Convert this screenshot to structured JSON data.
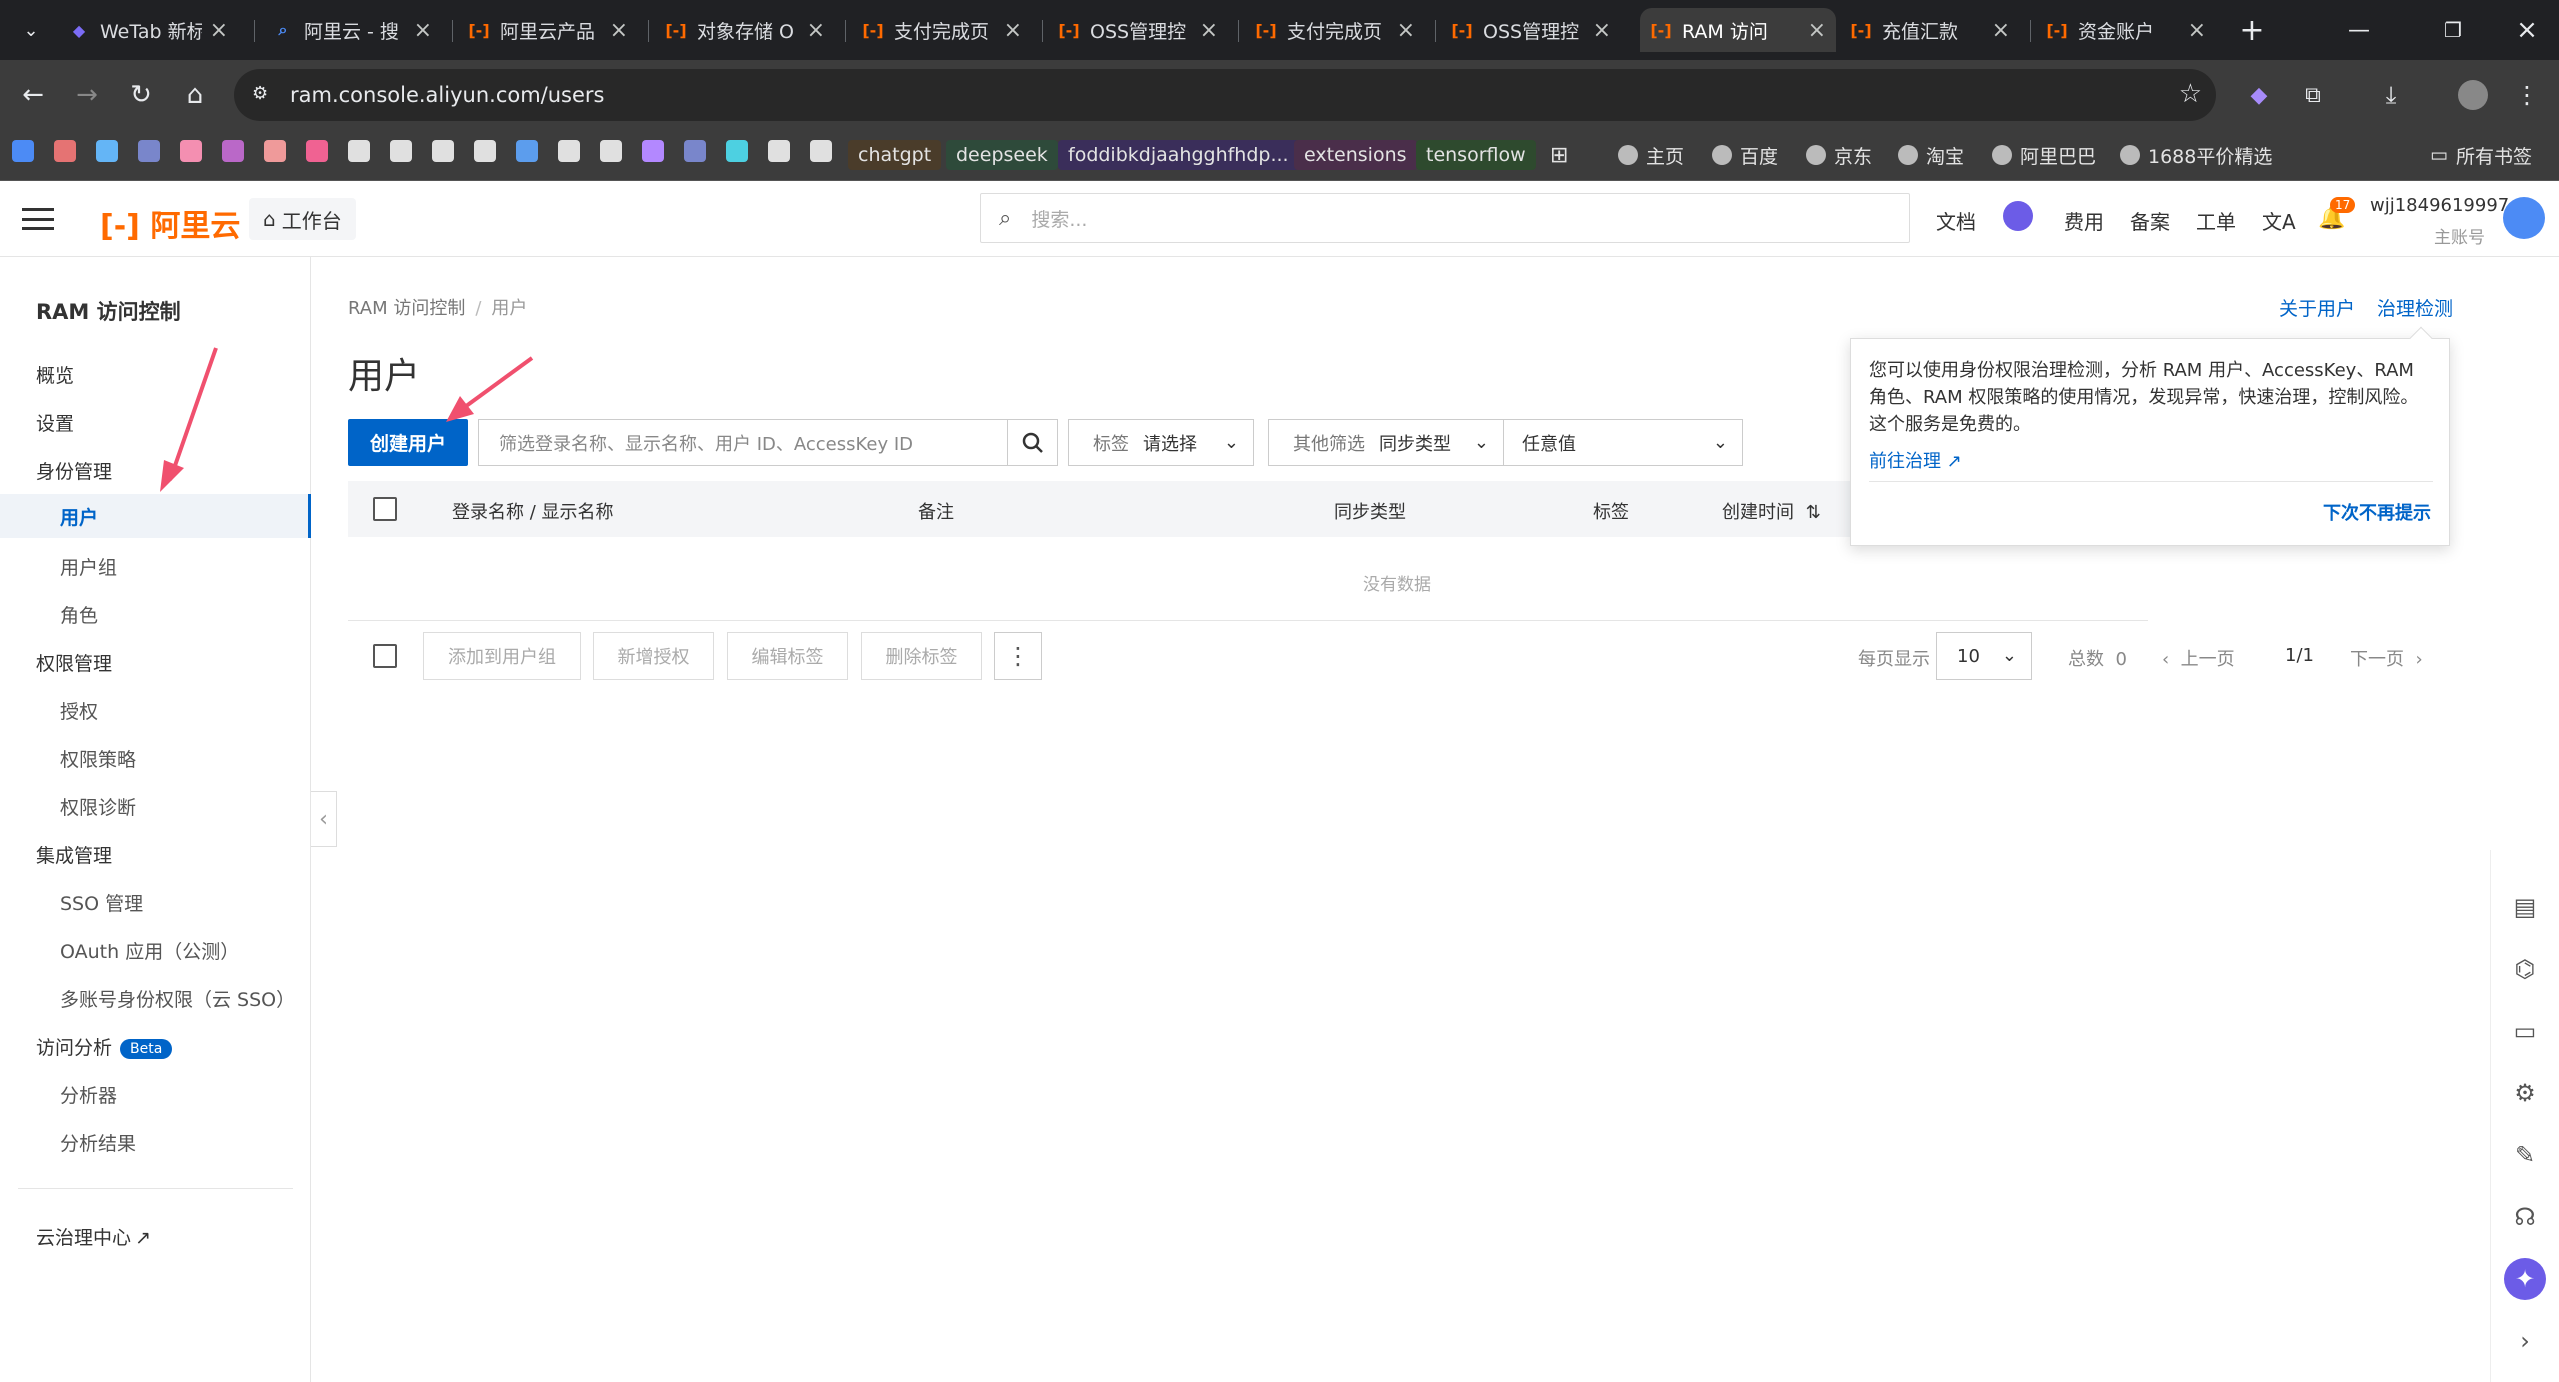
{
  "browser": {
    "tabs": [
      {
        "title": "WeTab 新标",
        "icon": "wetab-icon"
      },
      {
        "title": "阿里云 - 搜",
        "icon": "search-icon"
      },
      {
        "title": "阿里云产品",
        "icon": "aliyun-icon"
      },
      {
        "title": "对象存储 O",
        "icon": "aliyun-icon"
      },
      {
        "title": "支付完成页",
        "icon": "aliyun-icon"
      },
      {
        "title": "OSS管理控",
        "icon": "aliyun-icon"
      },
      {
        "title": "支付完成页",
        "icon": "aliyun-icon"
      },
      {
        "title": "OSS管理控",
        "icon": "aliyun-icon"
      },
      {
        "title": "RAM 访问",
        "icon": "aliyun-icon",
        "active": true
      },
      {
        "title": "充值汇款",
        "icon": "aliyun-icon"
      },
      {
        "title": "资金账户",
        "icon": "aliyun-icon"
      }
    ],
    "url": "ram.console.aliyun.com/users",
    "bookmarks": {
      "tags": [
        "chatgpt",
        "deepseek",
        "foddibkdjaahgghfhdp...",
        "extensions",
        "tensorflow"
      ],
      "links": [
        "主页",
        "百度",
        "京东",
        "淘宝",
        "阿里巴巴",
        "1688平价精选"
      ],
      "all_bookmarks": "所有书签"
    }
  },
  "console": {
    "logo": "阿里云",
    "workbench": "工作台",
    "search_placeholder": "搜索...",
    "links": [
      "文档",
      "费用",
      "备案",
      "工单"
    ],
    "notification_count": "17",
    "account_name": "wjj1849619997",
    "account_role": "主账号"
  },
  "sidebar": {
    "title": "RAM 访问控制",
    "overview": "概览",
    "settings": "设置",
    "identity": "身份管理",
    "users": "用户",
    "user_groups": "用户组",
    "roles": "角色",
    "permissions": "权限管理",
    "grants": "授权",
    "policies": "权限策略",
    "diagnostics": "权限诊断",
    "integration": "集成管理",
    "sso": "SSO 管理",
    "oauth": "OAuth 应用（公测）",
    "multi_sso": "多账号身份权限（云 SSO）",
    "access_analysis": "访问分析",
    "beta": "Beta",
    "analyzer": "分析器",
    "analysis_results": "分析结果",
    "governance_center": "云治理中心"
  },
  "main": {
    "breadcrumb_root": "RAM 访问控制",
    "breadcrumb_current": "用户",
    "title": "用户",
    "about_users": "关于用户",
    "governance_check": "治理检测",
    "create_user": "创建用户",
    "filter_placeholder": "筛选登录名称、显示名称、用户 ID、AccessKey ID",
    "tag_label": "标签",
    "tag_value": "请选择",
    "other_filter_label": "其他筛选",
    "other_filter_value": "同步类型",
    "any_value": "任意值",
    "columns": [
      "登录名称 / 显示名称",
      "备注",
      "同步类型",
      "标签",
      "创建时间"
    ],
    "no_data": "没有数据",
    "bulk_actions": [
      "添加到用户组",
      "新增授权",
      "编辑标签",
      "删除标签"
    ],
    "page_size_label": "每页显示",
    "page_size": "10",
    "total_label": "总数",
    "total": "0",
    "prev": "上一页",
    "page_indicator": "1/1",
    "next": "下一页"
  },
  "popover": {
    "text": "您可以使用身份权限治理检测，分析 RAM 用户、AccessKey、RAM 角色、RAM 权限策略的使用情况，发现异常，快速治理，控制风险。这个服务是免费的。",
    "go_link": "前往治理",
    "dismiss": "下次不再提示"
  },
  "colors": {
    "primary": "#0064c8",
    "brand": "#ff6a00",
    "annotation_arrow": "#f0506e"
  }
}
